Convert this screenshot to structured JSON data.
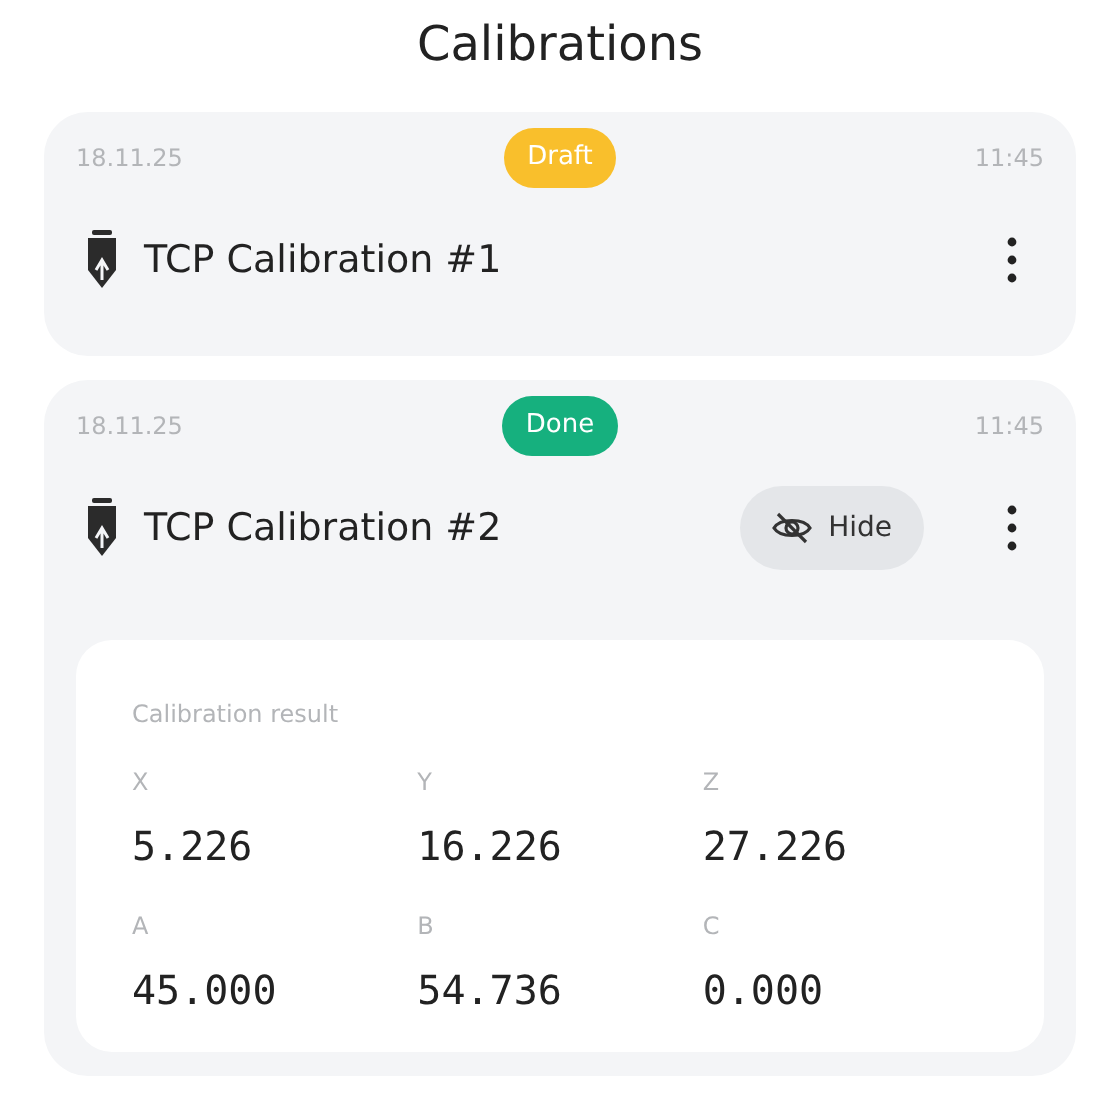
{
  "title": "Calibrations",
  "calibrations": [
    {
      "date": "18.11.25",
      "status": {
        "kind": "draft",
        "label": "Draft"
      },
      "time": "11:45",
      "name": "TCP Calibration #1"
    },
    {
      "date": "18.11.25",
      "status": {
        "kind": "done",
        "label": "Done"
      },
      "time": "11:45",
      "name": "TCP Calibration #2",
      "hide_button": "Hide",
      "result": {
        "heading": "Calibration result",
        "values": [
          {
            "label": "X",
            "value": "5.226"
          },
          {
            "label": "Y",
            "value": "16.226"
          },
          {
            "label": "Z",
            "value": "27.226"
          },
          {
            "label": "A",
            "value": "45.000"
          },
          {
            "label": "B",
            "value": "54.736"
          },
          {
            "label": "C",
            "value": "0.000"
          }
        ]
      }
    }
  ]
}
